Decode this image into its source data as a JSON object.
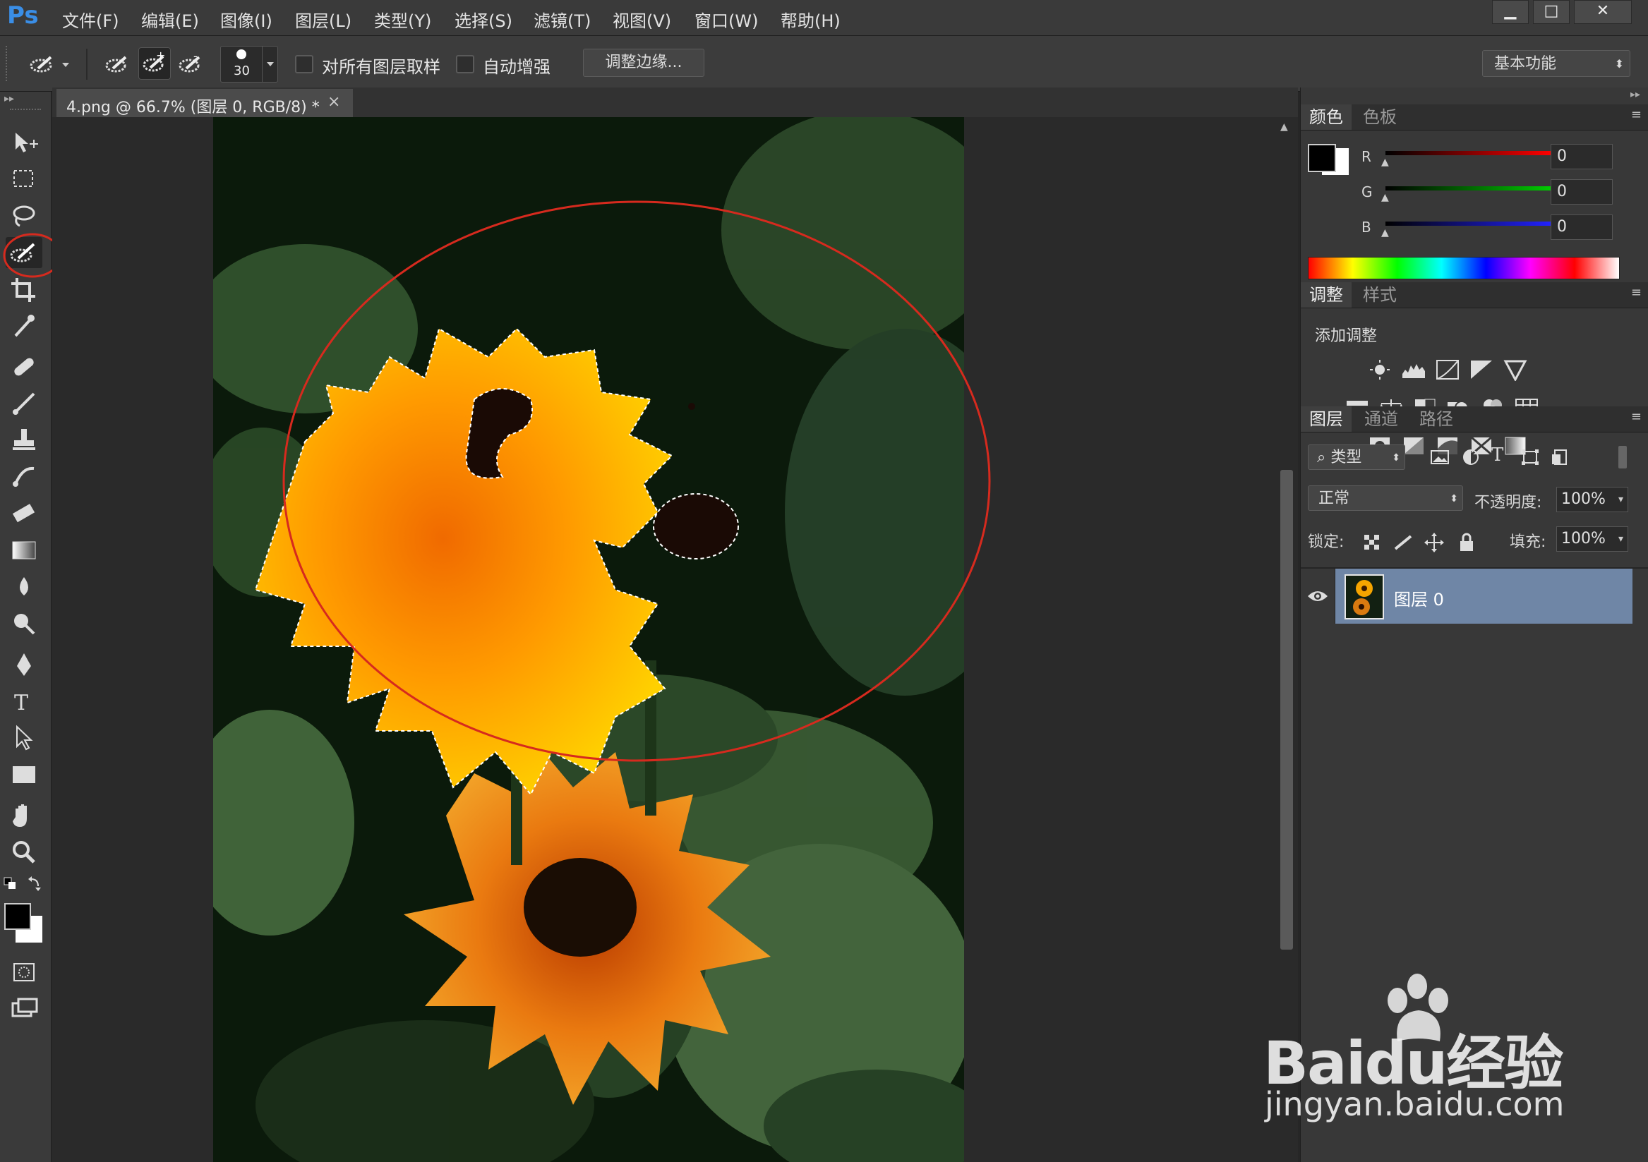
{
  "app": {
    "logo": "Ps"
  },
  "menu": [
    "文件(F)",
    "编辑(E)",
    "图像(I)",
    "图层(L)",
    "类型(Y)",
    "选择(S)",
    "滤镜(T)",
    "视图(V)",
    "窗口(W)",
    "帮助(H)"
  ],
  "window_controls": [
    "▁",
    "□",
    "✕"
  ],
  "options_bar": {
    "brush_size": "30",
    "sample_all_layers_label": "对所有图层取样",
    "auto_enhance_label": "自动增强",
    "refine_edge_button": "调整边缘...",
    "workspace": "基本功能"
  },
  "document_tab": {
    "title": "4.png @ 66.7% (图层 0, RGB/8) *",
    "close": "×"
  },
  "color_panel": {
    "tabs": [
      "颜色",
      "色板"
    ],
    "r_label": "R",
    "g_label": "G",
    "b_label": "B",
    "r_value": "0",
    "g_value": "0",
    "b_value": "0"
  },
  "adjust_panel": {
    "tabs": [
      "调整",
      "样式"
    ],
    "heading": "添加调整"
  },
  "layers_panel": {
    "tabs": [
      "图层",
      "通道",
      "路径"
    ],
    "filter": "类型",
    "blend_mode": "正常",
    "opacity_label": "不透明度:",
    "opacity": "100%",
    "lock_label": "锁定:",
    "fill_label": "填充:",
    "fill": "100%",
    "layer_name": "图层 0"
  },
  "watermark": {
    "brand": "Baidu经验",
    "url": "jingyan.baidu.com"
  },
  "colors": {
    "accent_red": "#d62a1e",
    "selection_yellow": "#f5b400",
    "layer_selected": "#6f86a6"
  }
}
